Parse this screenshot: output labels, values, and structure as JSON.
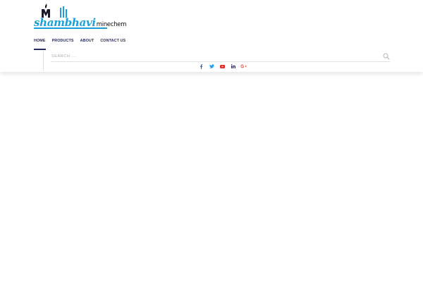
{
  "logo": {
    "brand": "shambhavi",
    "suffix": "minechem"
  },
  "nav": {
    "items": [
      {
        "label": "HOME",
        "active": true
      },
      {
        "label": "PRODUCTS",
        "active": false
      },
      {
        "label": "ABOUT",
        "active": false
      },
      {
        "label": "CONTACT US",
        "active": false
      }
    ]
  },
  "search": {
    "placeholder": "SEARCH ..."
  },
  "social": {
    "icons": [
      "facebook-icon",
      "twitter-icon",
      "youtube-icon",
      "linkedin-icon",
      "google-plus-icon"
    ]
  },
  "colors": {
    "brand_blue": "#1ba0d8",
    "nav_text": "#2b2b5a",
    "facebook": "#3b5998",
    "twitter": "#1da1f2",
    "youtube": "#e52d27",
    "linkedin": "#0e76a8",
    "google_plus": "#dd4b39"
  }
}
